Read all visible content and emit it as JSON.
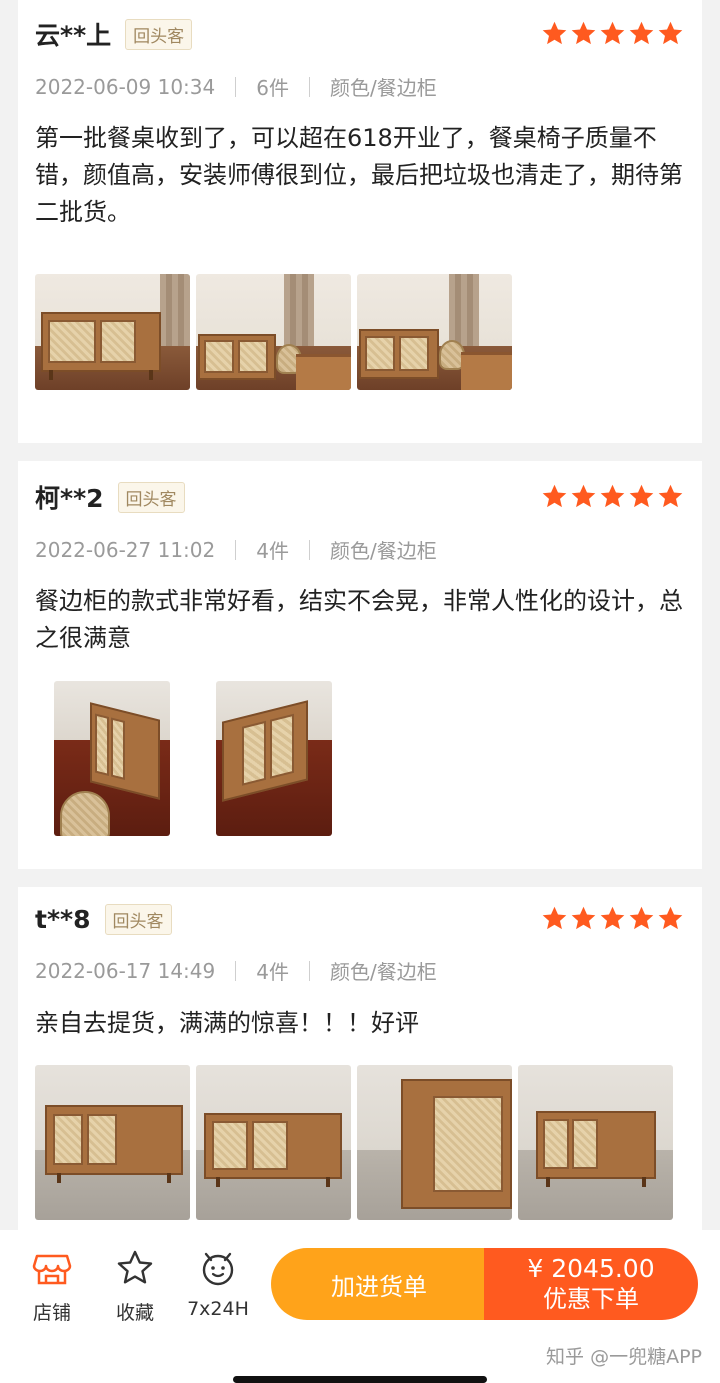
{
  "colors": {
    "star": "#ff5a1f",
    "accent_orange": "#ffa31a",
    "buy_orange": "#ff5a1f",
    "tag_text": "#a08860"
  },
  "reviews": [
    {
      "user": "云**上",
      "tag": "回头客",
      "rating": 5,
      "date": "2022-06-09 10:34",
      "qty": "6件",
      "variant": "颜色/餐边柜",
      "text": "第一批餐桌收到了，可以超在618开业了，餐桌椅子质量不错，颜值高，安装师傅很到位，最后把垃圾也清走了，期待第二批货。",
      "photos": 3
    },
    {
      "user": "柯**2",
      "tag": "回头客",
      "rating": 5,
      "date": "2022-06-27 11:02",
      "qty": "4件",
      "variant": "颜色/餐边柜",
      "text": "餐边柜的款式非常好看，结实不会晃，非常人性化的设计，总之很满意",
      "photos": 2
    },
    {
      "user": "t**8",
      "tag": "回头客",
      "rating": 5,
      "date": "2022-06-17 14:49",
      "qty": "4件",
      "variant": "颜色/餐边柜",
      "text": "亲自去提货，满满的惊喜！！！好评",
      "photos": 4
    }
  ],
  "bottom_bar": {
    "tabs": [
      {
        "label": "店铺",
        "icon": "store-icon"
      },
      {
        "label": "收藏",
        "icon": "star-outline-icon"
      },
      {
        "label": "7x24H",
        "icon": "chat-bot-icon"
      }
    ],
    "add_to_cart": "加进货单",
    "price": "¥ 2045.00",
    "buy_label": "优惠下单"
  },
  "watermark": "知乎 @一兜糖APP"
}
